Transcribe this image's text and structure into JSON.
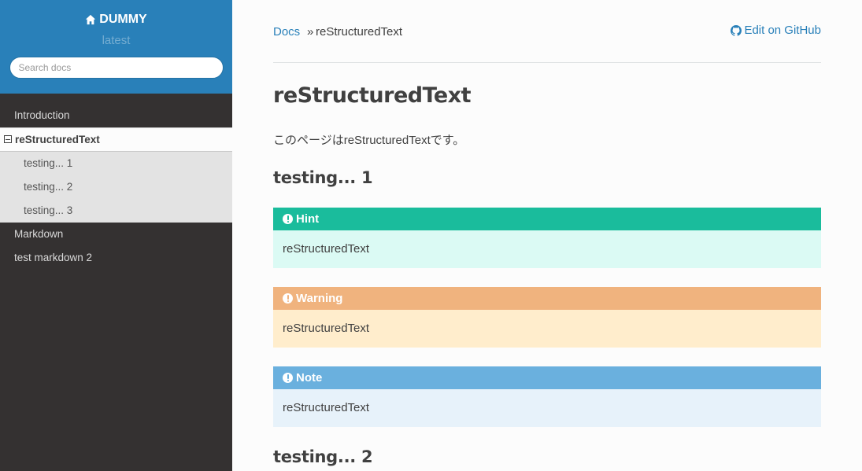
{
  "sidebar": {
    "project_name": "DUMMY",
    "version": "latest",
    "search_placeholder": "Search docs",
    "items": [
      {
        "label": "Introduction"
      },
      {
        "label": "reStructuredText"
      },
      {
        "label": "testing... 1"
      },
      {
        "label": "testing... 2"
      },
      {
        "label": "testing... 3"
      },
      {
        "label": "Markdown"
      },
      {
        "label": "test markdown 2"
      }
    ]
  },
  "breadcrumbs": {
    "root": "Docs",
    "separator": "»",
    "current": "reStructuredText",
    "edit_link": "Edit on GitHub"
  },
  "content": {
    "title": "reStructuredText",
    "intro": "このページはreStructuredTextです。",
    "sections": [
      {
        "heading": "testing... 1"
      },
      {
        "heading": "testing... 2"
      }
    ],
    "admonitions": [
      {
        "type": "hint",
        "title": "Hint",
        "body": "reStructuredText",
        "color": "#1abc9c"
      },
      {
        "type": "warning",
        "title": "Warning",
        "body": "reStructuredText",
        "color": "#f0b37e"
      },
      {
        "type": "note",
        "title": "Note",
        "body": "reStructuredText",
        "color": "#6ab0de"
      }
    ]
  },
  "colors": {
    "accent": "#2980b9",
    "sidebar_bg": "#343131"
  },
  "icons": [
    "home-icon",
    "github-icon",
    "exclamation-circle-icon"
  ]
}
